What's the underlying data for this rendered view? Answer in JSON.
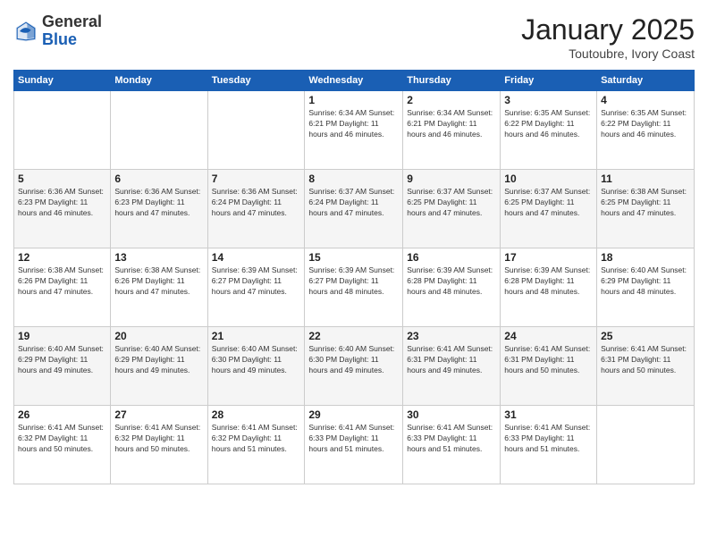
{
  "header": {
    "logo_line1": "General",
    "logo_line2": "Blue",
    "month_title": "January 2025",
    "subtitle": "Toutoubre, Ivory Coast"
  },
  "weekdays": [
    "Sunday",
    "Monday",
    "Tuesday",
    "Wednesday",
    "Thursday",
    "Friday",
    "Saturday"
  ],
  "weeks": [
    [
      {
        "day": "",
        "info": ""
      },
      {
        "day": "",
        "info": ""
      },
      {
        "day": "",
        "info": ""
      },
      {
        "day": "1",
        "info": "Sunrise: 6:34 AM\nSunset: 6:21 PM\nDaylight: 11 hours\nand 46 minutes."
      },
      {
        "day": "2",
        "info": "Sunrise: 6:34 AM\nSunset: 6:21 PM\nDaylight: 11 hours\nand 46 minutes."
      },
      {
        "day": "3",
        "info": "Sunrise: 6:35 AM\nSunset: 6:22 PM\nDaylight: 11 hours\nand 46 minutes."
      },
      {
        "day": "4",
        "info": "Sunrise: 6:35 AM\nSunset: 6:22 PM\nDaylight: 11 hours\nand 46 minutes."
      }
    ],
    [
      {
        "day": "5",
        "info": "Sunrise: 6:36 AM\nSunset: 6:23 PM\nDaylight: 11 hours\nand 46 minutes."
      },
      {
        "day": "6",
        "info": "Sunrise: 6:36 AM\nSunset: 6:23 PM\nDaylight: 11 hours\nand 47 minutes."
      },
      {
        "day": "7",
        "info": "Sunrise: 6:36 AM\nSunset: 6:24 PM\nDaylight: 11 hours\nand 47 minutes."
      },
      {
        "day": "8",
        "info": "Sunrise: 6:37 AM\nSunset: 6:24 PM\nDaylight: 11 hours\nand 47 minutes."
      },
      {
        "day": "9",
        "info": "Sunrise: 6:37 AM\nSunset: 6:25 PM\nDaylight: 11 hours\nand 47 minutes."
      },
      {
        "day": "10",
        "info": "Sunrise: 6:37 AM\nSunset: 6:25 PM\nDaylight: 11 hours\nand 47 minutes."
      },
      {
        "day": "11",
        "info": "Sunrise: 6:38 AM\nSunset: 6:25 PM\nDaylight: 11 hours\nand 47 minutes."
      }
    ],
    [
      {
        "day": "12",
        "info": "Sunrise: 6:38 AM\nSunset: 6:26 PM\nDaylight: 11 hours\nand 47 minutes."
      },
      {
        "day": "13",
        "info": "Sunrise: 6:38 AM\nSunset: 6:26 PM\nDaylight: 11 hours\nand 47 minutes."
      },
      {
        "day": "14",
        "info": "Sunrise: 6:39 AM\nSunset: 6:27 PM\nDaylight: 11 hours\nand 47 minutes."
      },
      {
        "day": "15",
        "info": "Sunrise: 6:39 AM\nSunset: 6:27 PM\nDaylight: 11 hours\nand 48 minutes."
      },
      {
        "day": "16",
        "info": "Sunrise: 6:39 AM\nSunset: 6:28 PM\nDaylight: 11 hours\nand 48 minutes."
      },
      {
        "day": "17",
        "info": "Sunrise: 6:39 AM\nSunset: 6:28 PM\nDaylight: 11 hours\nand 48 minutes."
      },
      {
        "day": "18",
        "info": "Sunrise: 6:40 AM\nSunset: 6:29 PM\nDaylight: 11 hours\nand 48 minutes."
      }
    ],
    [
      {
        "day": "19",
        "info": "Sunrise: 6:40 AM\nSunset: 6:29 PM\nDaylight: 11 hours\nand 49 minutes."
      },
      {
        "day": "20",
        "info": "Sunrise: 6:40 AM\nSunset: 6:29 PM\nDaylight: 11 hours\nand 49 minutes."
      },
      {
        "day": "21",
        "info": "Sunrise: 6:40 AM\nSunset: 6:30 PM\nDaylight: 11 hours\nand 49 minutes."
      },
      {
        "day": "22",
        "info": "Sunrise: 6:40 AM\nSunset: 6:30 PM\nDaylight: 11 hours\nand 49 minutes."
      },
      {
        "day": "23",
        "info": "Sunrise: 6:41 AM\nSunset: 6:31 PM\nDaylight: 11 hours\nand 49 minutes."
      },
      {
        "day": "24",
        "info": "Sunrise: 6:41 AM\nSunset: 6:31 PM\nDaylight: 11 hours\nand 50 minutes."
      },
      {
        "day": "25",
        "info": "Sunrise: 6:41 AM\nSunset: 6:31 PM\nDaylight: 11 hours\nand 50 minutes."
      }
    ],
    [
      {
        "day": "26",
        "info": "Sunrise: 6:41 AM\nSunset: 6:32 PM\nDaylight: 11 hours\nand 50 minutes."
      },
      {
        "day": "27",
        "info": "Sunrise: 6:41 AM\nSunset: 6:32 PM\nDaylight: 11 hours\nand 50 minutes."
      },
      {
        "day": "28",
        "info": "Sunrise: 6:41 AM\nSunset: 6:32 PM\nDaylight: 11 hours\nand 51 minutes."
      },
      {
        "day": "29",
        "info": "Sunrise: 6:41 AM\nSunset: 6:33 PM\nDaylight: 11 hours\nand 51 minutes."
      },
      {
        "day": "30",
        "info": "Sunrise: 6:41 AM\nSunset: 6:33 PM\nDaylight: 11 hours\nand 51 minutes."
      },
      {
        "day": "31",
        "info": "Sunrise: 6:41 AM\nSunset: 6:33 PM\nDaylight: 11 hours\nand 51 minutes."
      },
      {
        "day": "",
        "info": ""
      }
    ]
  ]
}
